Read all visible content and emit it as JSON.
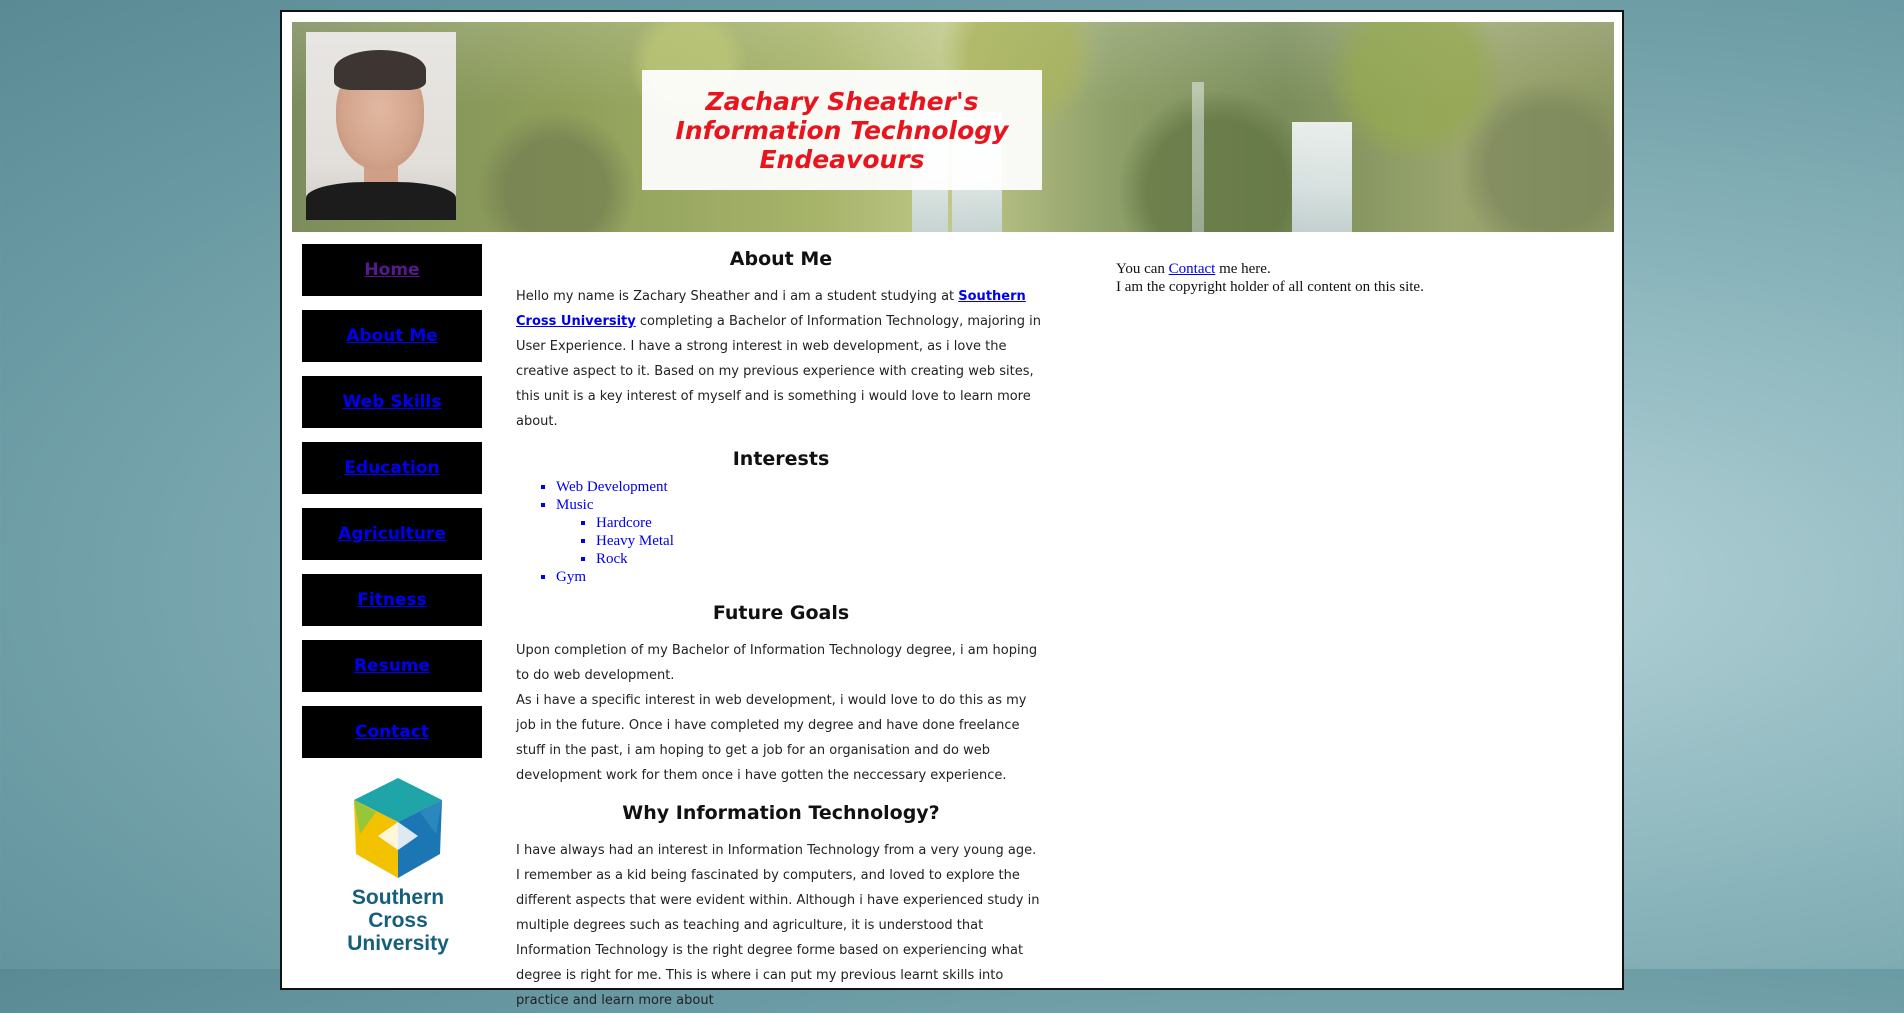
{
  "header": {
    "title": "Zachary Sheather's Information Technology Endeavours"
  },
  "nav": {
    "items": [
      {
        "label": "Home"
      },
      {
        "label": "About Me"
      },
      {
        "label": "Web Skills"
      },
      {
        "label": "Education"
      },
      {
        "label": "Agriculture"
      },
      {
        "label": "Fitness"
      },
      {
        "label": "Resume"
      },
      {
        "label": "Contact"
      }
    ]
  },
  "logo": {
    "name": "Southern Cross University",
    "colors": {
      "yellow": "#f2c200",
      "teal": "#17a3a5",
      "blue": "#1b6fb0"
    }
  },
  "main": {
    "about_heading": "About Me",
    "about_text_1": "Hello my name is Zachary Sheather and i am a student studying at ",
    "about_link": "Southern Cross University",
    "about_text_2": " completing a Bachelor of Information Technology, majoring in User Experience. I have a strong interest in web development, as i love the creative aspect to it. Based on my previous experience with creating web sites, this unit is a key interest of myself and is something i would love to learn more about.",
    "interests_heading": "Interests",
    "interests": {
      "web": "Web Development",
      "music": "Music",
      "music_sub": [
        "Hardcore",
        "Heavy Metal",
        "Rock"
      ],
      "gym": "Gym"
    },
    "goals_heading": "Future Goals",
    "goals_text_1": "Upon completion of my Bachelor of Information Technology degree, i am hoping to do web development.",
    "goals_text_2": "As i have a specific interest in web development, i would love to do this as my job in the future. Once i have completed my degree and have done freelance stuff in the past, i am hoping to get a job for an organisation and do web development work for them once i have gotten the neccessary experience.",
    "why_heading": "Why Information Technology?",
    "why_text_1": "I have always had an interest in Information Technology from a very young age.",
    "why_text_2": "I remember as a kid being fascinated by computers, and loved to explore the different aspects that were evident within. Although i have experienced study in multiple degrees such as teaching and agriculture, it is understood that Information Technology is the right degree forme based on experiencing what degree is right for me. This is where i can put my previous learnt skills into practice and learn more about"
  },
  "side": {
    "contact_prefix": "You can ",
    "contact_link": "Contact",
    "contact_suffix": " me here.",
    "copyright": "I am the copyright holder of all content on this site."
  }
}
